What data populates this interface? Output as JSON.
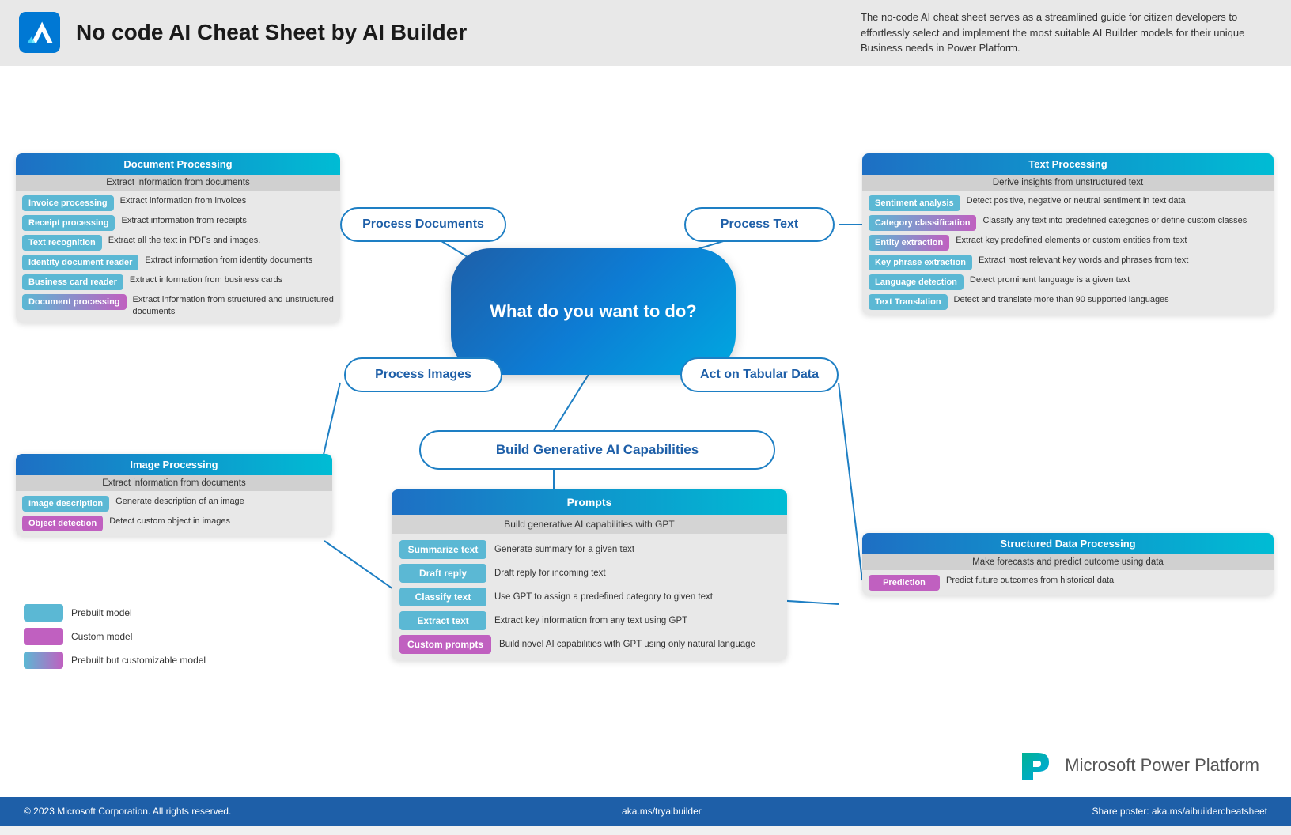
{
  "header": {
    "title": "No code AI Cheat Sheet by AI Builder",
    "description": "The no-code AI cheat sheet serves as a streamlined guide for citizen developers to effortlessly select and implement the most suitable AI Builder models for their unique Business needs in Power Platform."
  },
  "central": {
    "label": "What do you want to do?"
  },
  "flow_nodes": {
    "process_documents": "Process Documents",
    "process_text": "Process Text",
    "process_images": "Process Images",
    "act_tabular": "Act on Tabular Data",
    "build_gen_ai": "Build Generative AI Capabilities"
  },
  "doc_processing": {
    "header": "Document Processing",
    "subtitle": "Extract information from documents",
    "items": [
      {
        "tag": "Invoice processing",
        "desc": "Extract information from invoices",
        "type": "blue"
      },
      {
        "tag": "Receipt processing",
        "desc": "Extract information from receipts",
        "type": "blue"
      },
      {
        "tag": "Text  recognition",
        "desc": "Extract all the text in PDFs and images.",
        "type": "blue"
      },
      {
        "tag": "Identity document reader",
        "desc": "Extract information from identity documents",
        "type": "blue"
      },
      {
        "tag": "Business card reader",
        "desc": "Extract information from business cards",
        "type": "blue"
      },
      {
        "tag": "Document processing",
        "desc": "Extract information from structured and unstructured documents",
        "type": "gradient"
      }
    ]
  },
  "text_processing": {
    "header": "Text Processing",
    "subtitle": "Derive insights from unstructured text",
    "items": [
      {
        "tag": "Sentiment analysis",
        "desc": "Detect positive, negative or neutral sentiment in text data",
        "type": "blue"
      },
      {
        "tag": "Category classification",
        "desc": "Classify any text into predefined categories or define custom classes",
        "type": "gradient"
      },
      {
        "tag": "Entity extraction",
        "desc": "Extract key predefined elements or custom entities from text",
        "type": "gradient"
      },
      {
        "tag": "Key phrase extraction",
        "desc": "Extract most relevant key words and phrases from text",
        "type": "blue"
      },
      {
        "tag": "Language detection",
        "desc": "Detect prominent language is a given text",
        "type": "blue"
      },
      {
        "tag": "Text Translation",
        "desc": "Detect and translate more than 90 supported languages",
        "type": "blue"
      }
    ]
  },
  "image_processing": {
    "header": "Image Processing",
    "subtitle": "Extract information from documents",
    "items": [
      {
        "tag": "Image description",
        "desc": "Generate description of an image",
        "type": "blue"
      },
      {
        "tag": "Object detection",
        "desc": "Detect custom object in images",
        "type": "purple"
      }
    ]
  },
  "structured_data": {
    "header": "Structured Data Processing",
    "subtitle": "Make forecasts and predict outcome using data",
    "items": [
      {
        "tag": "Prediction",
        "desc": "Predict future outcomes from historical data",
        "type": "purple"
      }
    ]
  },
  "prompts": {
    "header": "Prompts",
    "subtitle": "Build generative AI capabilities with GPT",
    "items": [
      {
        "tag": "Summarize text",
        "desc": "Generate summary for a given text",
        "type": "blue"
      },
      {
        "tag": "Draft reply",
        "desc": "Draft reply for incoming text",
        "type": "blue"
      },
      {
        "tag": "Classify text",
        "desc": "Use GPT to assign a predefined category to given text",
        "type": "blue"
      },
      {
        "tag": "Extract text",
        "desc": "Extract key information from any text using GPT",
        "type": "blue"
      },
      {
        "tag": "Custom prompts",
        "desc": "Build novel AI capabilities with GPT using only natural language",
        "type": "purple"
      }
    ]
  },
  "legend": {
    "items": [
      {
        "label": "Prebuilt model",
        "type": "blue"
      },
      {
        "label": "Custom model",
        "type": "purple"
      },
      {
        "label": "Prebuilt but customizable model",
        "type": "gradient"
      }
    ]
  },
  "footer": {
    "copyright": "© 2023 Microsoft Corporation. All rights reserved.",
    "link": "aka.ms/tryaibuilder",
    "share": "Share poster: aka.ms/aibuildercheatsheet"
  },
  "power_platform": {
    "label": "Microsoft Power Platform"
  }
}
